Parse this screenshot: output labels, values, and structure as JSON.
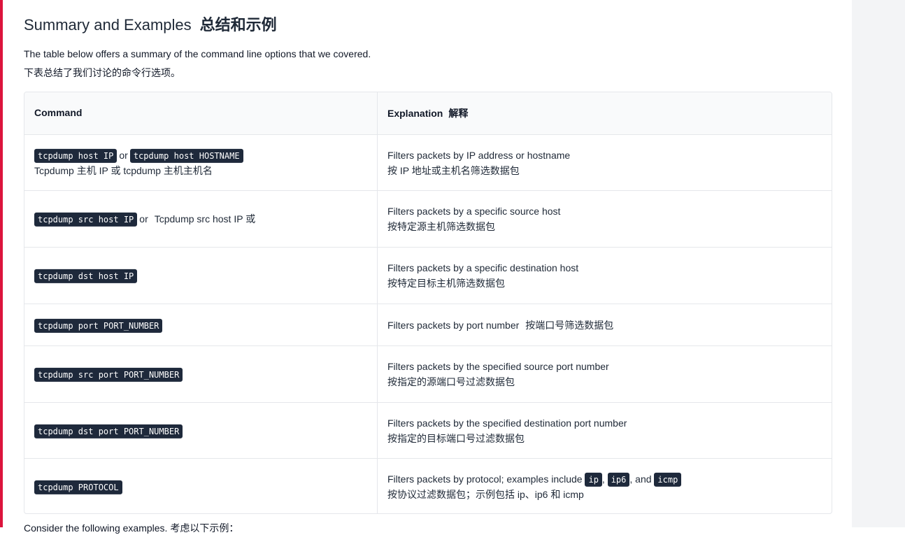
{
  "heading": {
    "en": "Summary and Examples",
    "zh": "总结和示例"
  },
  "intro": {
    "en": "The table below offers a summary of the command line options that we covered.",
    "zh": "下表总结了我们讨论的命令行选项。"
  },
  "table": {
    "headers": {
      "command": "Command",
      "explanation": "Explanation",
      "explanation_zh": "解释"
    },
    "rows": [
      {
        "code1": "tcpdump host IP",
        "connector": "or",
        "code2": "tcpdump host HOSTNAME",
        "cmd_note": "Tcpdump 主机 IP 或 tcpdump 主机主机名",
        "exp_en": "Filters packets by IP address or hostname",
        "exp_zh": "按 IP 地址或主机名筛选数据包"
      },
      {
        "code1": "tcpdump src host IP",
        "connector": "or",
        "cmd_tail": "Tcpdump src host IP 或",
        "exp_en": "Filters packets by a specific source host",
        "exp_zh": "按特定源主机筛选数据包"
      },
      {
        "code1": "tcpdump dst host IP",
        "exp_en": "Filters packets by a specific destination host",
        "exp_zh": "按特定目标主机筛选数据包"
      },
      {
        "code1": "tcpdump port PORT_NUMBER",
        "exp_en": "Filters packets by port number",
        "exp_zh": "按端口号筛选数据包"
      },
      {
        "code1": "tcpdump src port PORT_NUMBER",
        "exp_en": "Filters packets by the specified source port number",
        "exp_zh": "按指定的源端口号过滤数据包"
      },
      {
        "code1": "tcpdump dst port PORT_NUMBER",
        "exp_en": "Filters packets by the specified destination port number",
        "exp_zh": "按指定的目标端口号过滤数据包"
      },
      {
        "code1": "tcpdump PROTOCOL",
        "exp_en_prefix": "Filters packets by protocol; examples include",
        "proto1": "ip",
        "proto2": "ip6",
        "proto3": "icmp",
        "comma": ",",
        "and_text": ", and",
        "exp_zh": "按协议过滤数据包；示例包括 ip、ip6 和 icmp"
      }
    ]
  },
  "footer_partial": "Consider the following examples.  考虑以下示例："
}
